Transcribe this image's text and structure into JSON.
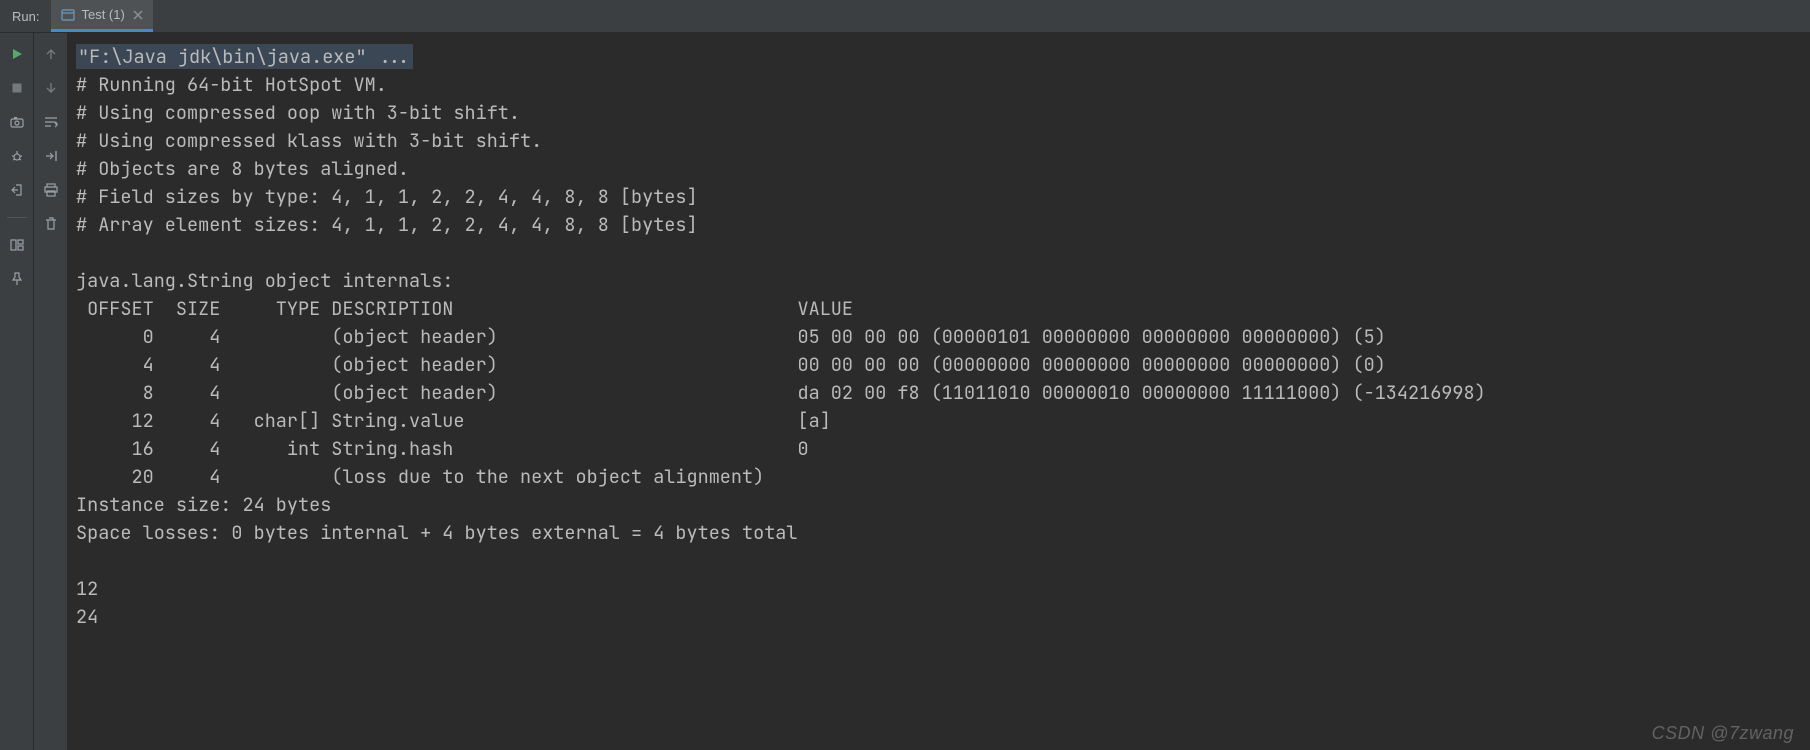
{
  "header": {
    "run_label": "Run:",
    "tab_label": "Test (1)"
  },
  "gutter_left_icons": [
    "play-icon",
    "stop-icon",
    "camera-icon",
    "bug-icon",
    "exit-icon",
    "layout-icon",
    "pin-icon"
  ],
  "gutter_mid_icons": [
    "arrow-up-icon",
    "arrow-down-icon",
    "wrap-icon",
    "scroll-icon",
    "print-icon",
    "trash-icon"
  ],
  "console": {
    "command": "\"F:\\Java jdk\\bin\\java.exe\" ...",
    "lines": [
      "# Running 64-bit HotSpot VM.",
      "# Using compressed oop with 3-bit shift.",
      "# Using compressed klass with 3-bit shift.",
      "# Objects are 8 bytes aligned.",
      "# Field sizes by type: 4, 1, 1, 2, 2, 4, 4, 8, 8 [bytes]",
      "# Array element sizes: 4, 1, 1, 2, 2, 4, 4, 8, 8 [bytes]",
      "",
      "java.lang.String object internals:",
      " OFFSET  SIZE     TYPE DESCRIPTION                               VALUE",
      "      0     4          (object header)                           05 00 00 00 (00000101 00000000 00000000 00000000) (5)",
      "      4     4          (object header)                           00 00 00 00 (00000000 00000000 00000000 00000000) (0)",
      "      8     4          (object header)                           da 02 00 f8 (11011010 00000010 00000000 11111000) (-134216998)",
      "     12     4   char[] String.value                              [a]",
      "     16     4      int String.hash                               0",
      "     20     4          (loss due to the next object alignment)",
      "Instance size: 24 bytes",
      "Space losses: 0 bytes internal + 4 bytes external = 4 bytes total",
      "",
      "12",
      "24"
    ]
  },
  "watermark": "CSDN @7zwang"
}
